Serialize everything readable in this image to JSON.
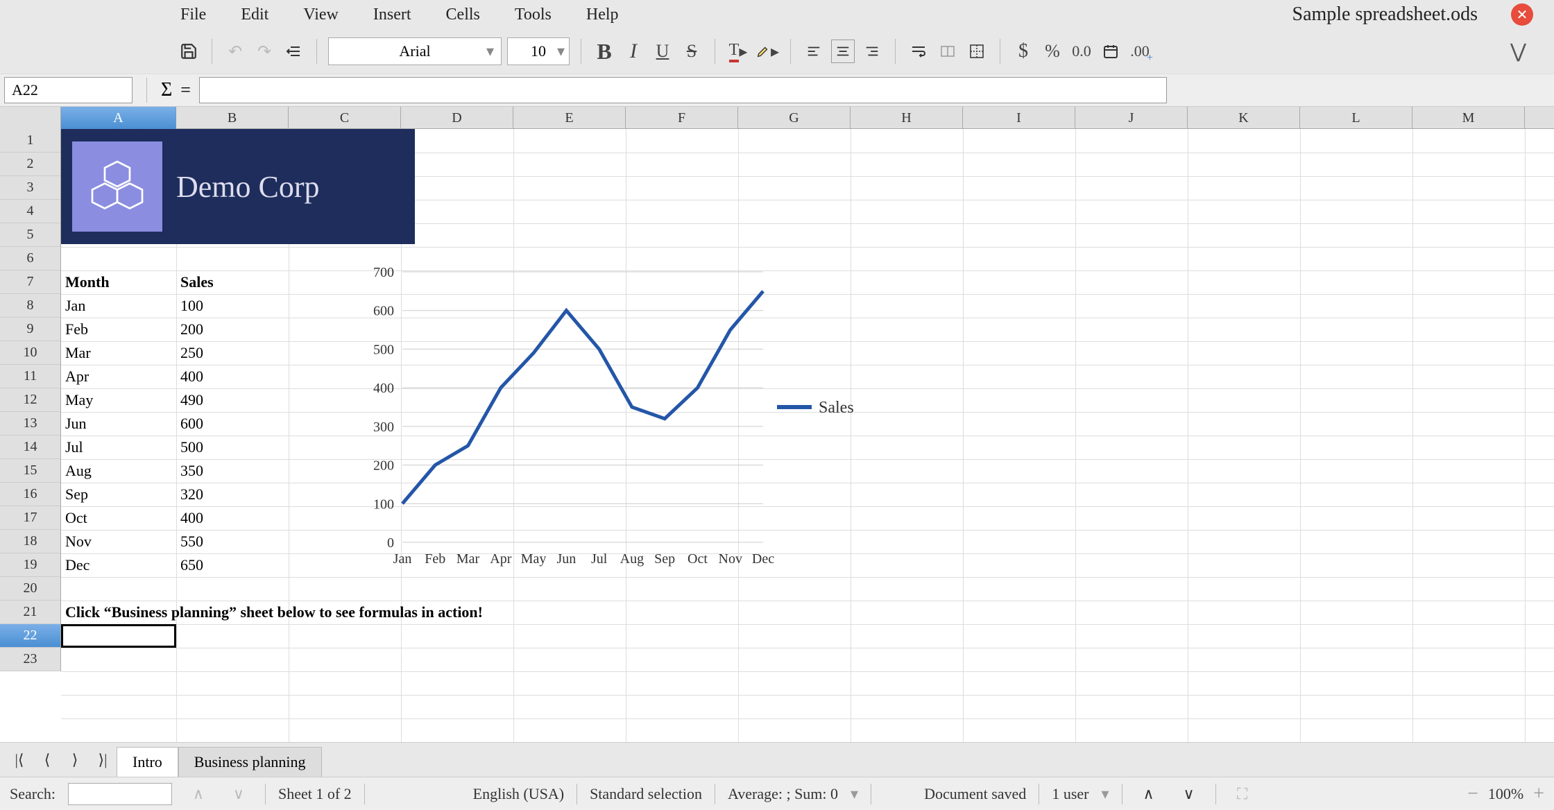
{
  "menu": {
    "file": "File",
    "edit": "Edit",
    "view": "View",
    "insert": "Insert",
    "cells": "Cells",
    "tools": "Tools",
    "help": "Help"
  },
  "doc_title": "Sample spreadsheet.ods",
  "toolbar": {
    "font": "Arial",
    "size": "10",
    "currency": "$",
    "percent": "%",
    "dec": "0.0",
    "adddec": ".00"
  },
  "cell_ref": "A22",
  "columns": [
    "A",
    "B",
    "C",
    "D",
    "E",
    "F",
    "G",
    "H",
    "I",
    "J",
    "K",
    "L",
    "M"
  ],
  "rows": [
    "1",
    "2",
    "3",
    "4",
    "5",
    "6",
    "7",
    "8",
    "9",
    "10",
    "11",
    "12",
    "13",
    "14",
    "15",
    "16",
    "17",
    "18",
    "19",
    "20",
    "21",
    "22",
    "23"
  ],
  "selected_row": "22",
  "logo_text": "Demo Corp",
  "table": {
    "header": {
      "month": "Month",
      "sales": "Sales"
    },
    "rows": [
      {
        "m": "Jan",
        "s": "100"
      },
      {
        "m": "Feb",
        "s": "200"
      },
      {
        "m": "Mar",
        "s": "250"
      },
      {
        "m": "Apr",
        "s": "400"
      },
      {
        "m": "May",
        "s": "490"
      },
      {
        "m": "Jun",
        "s": "600"
      },
      {
        "m": "Jul",
        "s": "500"
      },
      {
        "m": "Aug",
        "s": "350"
      },
      {
        "m": "Sep",
        "s": "320"
      },
      {
        "m": "Oct",
        "s": "400"
      },
      {
        "m": "Nov",
        "s": "550"
      },
      {
        "m": "Dec",
        "s": "650"
      }
    ]
  },
  "hint": "Click “Business planning” sheet below to see formulas in action!",
  "chart_data": {
    "type": "line",
    "categories": [
      "Jan",
      "Feb",
      "Mar",
      "Apr",
      "May",
      "Jun",
      "Jul",
      "Aug",
      "Sep",
      "Oct",
      "Nov",
      "Dec"
    ],
    "series": [
      {
        "name": "Sales",
        "values": [
          100,
          200,
          250,
          400,
          490,
          600,
          500,
          350,
          320,
          400,
          550,
          650
        ]
      }
    ],
    "ylim": [
      0,
      700
    ],
    "yticks": [
      0,
      100,
      200,
      300,
      400,
      500,
      600,
      700
    ],
    "xlabel": "",
    "ylabel": "",
    "title": ""
  },
  "sheet_tabs": {
    "active": "Intro",
    "other": "Business planning"
  },
  "status": {
    "search_label": "Search:",
    "sheet": "Sheet 1 of 2",
    "lang": "English (USA)",
    "sel": "Standard selection",
    "agg": "Average: ; Sum: 0",
    "saved": "Document saved",
    "users": "1 user",
    "zoom": "100%"
  }
}
